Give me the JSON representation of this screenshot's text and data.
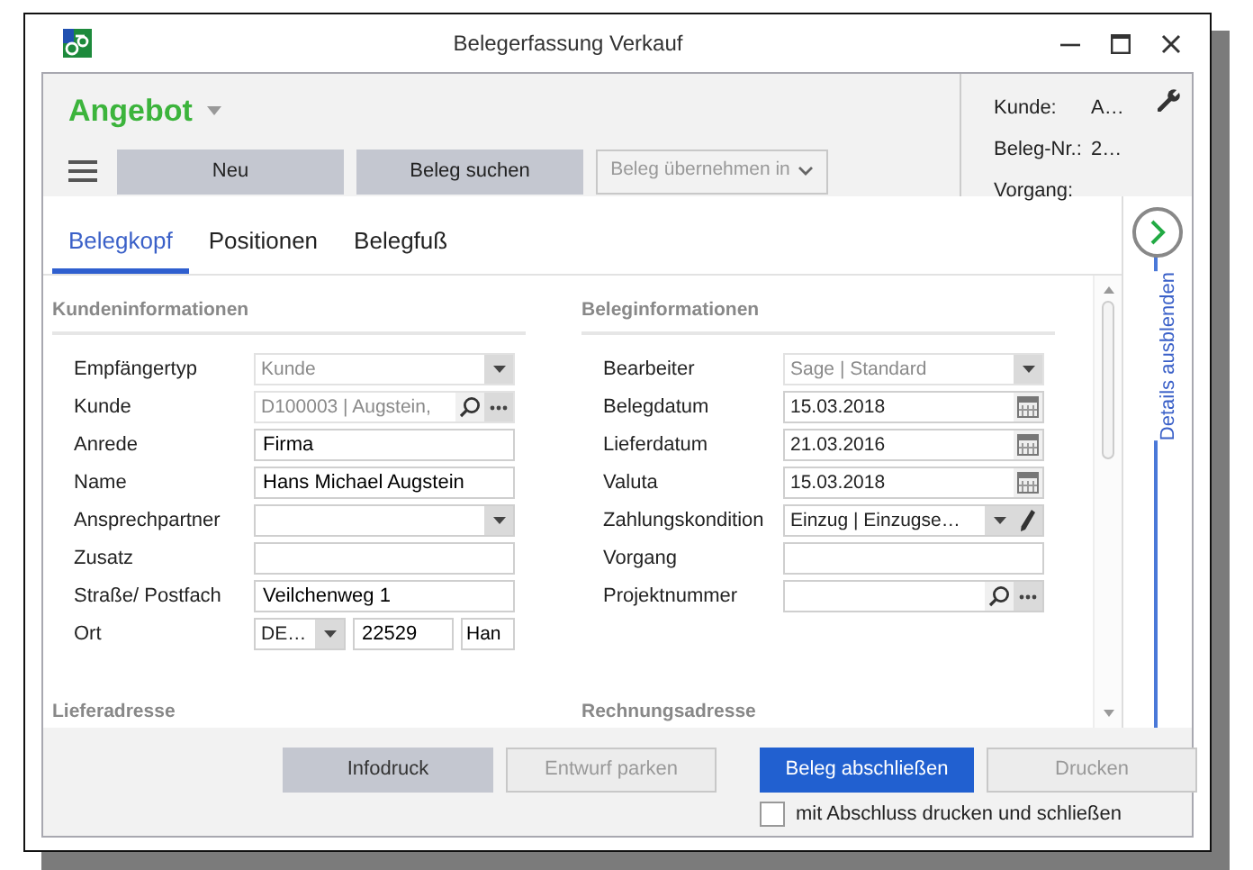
{
  "window": {
    "title": "Belegerfassung Verkauf"
  },
  "header": {
    "document_type": "Angebot",
    "buttons": [
      {
        "label": "Neu",
        "disabled": false,
        "kind": "plain"
      },
      {
        "label": "Beleg suchen",
        "disabled": false,
        "kind": "plain"
      },
      {
        "label": "Beleg übernehmen in",
        "disabled": true,
        "kind": "dropdown"
      }
    ]
  },
  "info_panel": [
    {
      "label": "Kunde:",
      "value": "A…"
    },
    {
      "label": "Beleg-Nr.:",
      "value": "2…"
    },
    {
      "label": "Vorgang:"
    }
  ],
  "tabs": [
    {
      "label": "Belegkopf",
      "selected": true
    },
    {
      "label": "Positionen",
      "selected": false
    },
    {
      "label": "Belegfuß",
      "selected": false
    }
  ],
  "sections": [
    {
      "title": "Kundeninformationen",
      "fields": [
        {
          "label": "Empfängertyp",
          "kind": "select",
          "value": "Kunde",
          "disabled": true
        },
        {
          "label": "Kunde",
          "kind": "lookup",
          "value": "D100003 | Augstein,",
          "disabled": true
        },
        {
          "label": "Anrede",
          "kind": "text",
          "value": "Firma",
          "disabled": false
        },
        {
          "label": "Name",
          "kind": "text",
          "value": "Hans Michael Augstein",
          "disabled": false
        },
        {
          "label": "Ansprechpartner",
          "kind": "select",
          "disabled": false
        },
        {
          "label": "Zusatz",
          "kind": "text",
          "disabled": false
        },
        {
          "label": "Straße/ Postfach",
          "kind": "text",
          "value": "Veilchenweg 1",
          "disabled": false
        },
        {
          "label": "Ort",
          "kind": "location",
          "country": "DE…",
          "zip": "22529",
          "city": "Han",
          "disabled": false
        }
      ],
      "next_title": "Lieferadresse"
    },
    {
      "title": "Beleginformationen",
      "fields": [
        {
          "label": "Bearbeiter",
          "kind": "select",
          "value": "Sage  |  Standard",
          "disabled": true
        },
        {
          "label": "Belegdatum",
          "kind": "date",
          "value": "15.03.2018",
          "disabled": false
        },
        {
          "label": "Lieferdatum",
          "kind": "date",
          "value": "21.03.2016",
          "disabled": false
        },
        {
          "label": "Valuta",
          "kind": "date",
          "value": "15.03.2018",
          "disabled": false
        },
        {
          "label": "Zahlungskondition",
          "kind": "select_edit",
          "value": "Einzug  |  Einzugse…",
          "disabled": false
        },
        {
          "label": "Vorgang",
          "kind": "text",
          "disabled": false
        },
        {
          "label": "Projektnummer",
          "kind": "lookup",
          "disabled": false
        }
      ],
      "next_title": "Rechnungsadresse"
    }
  ],
  "side_panel": {
    "label": "Details ausblenden"
  },
  "footer": {
    "buttons": [
      {
        "label": "Infodruck",
        "kind": "secondary",
        "disabled": false
      },
      {
        "label": "Entwurf parken",
        "kind": "secondary",
        "disabled": true
      },
      {
        "label": "Beleg abschließen",
        "kind": "primary",
        "disabled": false
      },
      {
        "label": "Drucken",
        "kind": "secondary",
        "disabled": true
      }
    ],
    "checkbox": {
      "label": "mit Abschluss drucken und schließen",
      "checked": false
    }
  }
}
